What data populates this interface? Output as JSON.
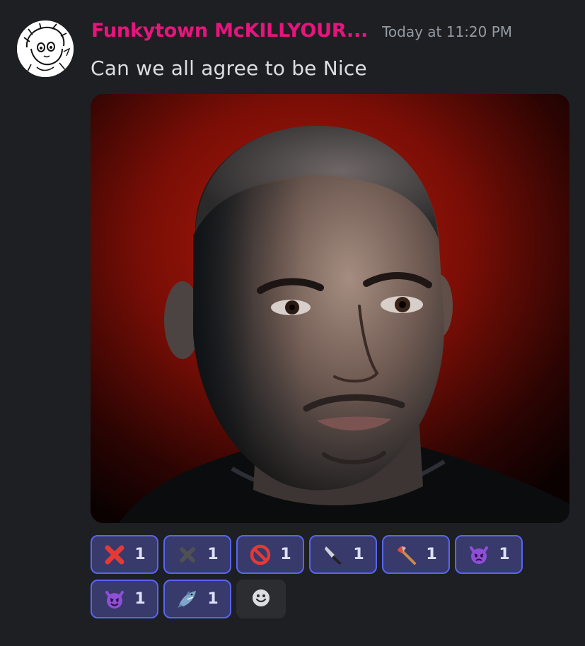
{
  "message": {
    "author": "Funkytown McKILLYOUR...",
    "timestamp": "Today at 11:20 PM",
    "content": "Can we all agree to be Nice",
    "author_color": "#e6157d"
  },
  "attachment": {
    "type": "image",
    "subject": "portrait-photo"
  },
  "reactions": [
    {
      "emoji": "cross-mark-icon",
      "count": "1"
    },
    {
      "emoji": "heavy-multiplication-x-icon",
      "count": "1"
    },
    {
      "emoji": "prohibited-icon",
      "count": "1"
    },
    {
      "emoji": "kitchen-knife-icon",
      "count": "1"
    },
    {
      "emoji": "axe-icon",
      "count": "1"
    },
    {
      "emoji": "angry-devil-icon",
      "count": "1"
    },
    {
      "emoji": "smiling-devil-icon",
      "count": "1"
    },
    {
      "emoji": "shark-icon",
      "count": "1"
    }
  ],
  "colors": {
    "background": "#1e1f22",
    "reaction_bg": "#373a6b",
    "reaction_border": "#5865f2"
  }
}
